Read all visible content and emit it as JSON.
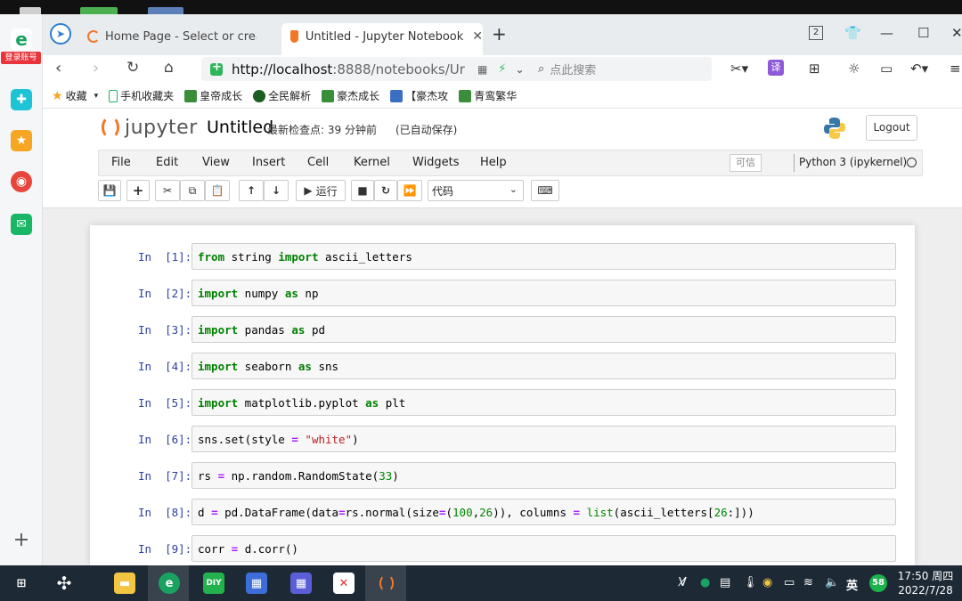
{
  "sidebar": {
    "login_label": "登录账号"
  },
  "tabs": [
    {
      "label": "Home Page - Select or create"
    },
    {
      "label": "Untitled - Jupyter Notebook"
    }
  ],
  "window": {
    "tab_count": "2"
  },
  "address": {
    "url_host": "http://localhost",
    "url_path": ":8888/notebooks/Ur",
    "search_placeholder": "点此搜索",
    "translate_label": "译"
  },
  "bookmarks": [
    {
      "label": "收藏"
    },
    {
      "label": "手机收藏夹"
    },
    {
      "label": "皇帝成长"
    },
    {
      "label": "全民解析"
    },
    {
      "label": "豪杰成长"
    },
    {
      "label": "【豪杰攻"
    },
    {
      "label": "青鸾繁华"
    }
  ],
  "jupyter": {
    "logo_text": "jupyter",
    "notebook_title": "Untitled",
    "checkpoint": "最新检查点: 39 分钟前",
    "autosave": "(已自动保存)",
    "logout_label": "Logout",
    "menu": [
      "File",
      "Edit",
      "View",
      "Insert",
      "Cell",
      "Kernel",
      "Widgets",
      "Help"
    ],
    "trusted_label": "可信",
    "kernel_name": "Python 3 (ipykernel)",
    "run_label": "运行",
    "cell_type": "代码"
  },
  "cells": [
    {
      "prompt": "In  [1]:",
      "code": "from string import ascii_letters"
    },
    {
      "prompt": "In  [2]:",
      "code": "import numpy as np"
    },
    {
      "prompt": "In  [3]:",
      "code": "import pandas as pd"
    },
    {
      "prompt": "In  [4]:",
      "code": "import seaborn as sns"
    },
    {
      "prompt": "In  [5]:",
      "code": "import matplotlib.pyplot as plt"
    },
    {
      "prompt": "In  [6]:",
      "code": "sns.set(style = \"white\")"
    },
    {
      "prompt": "In  [7]:",
      "code": "rs = np.random.RandomState(33)"
    },
    {
      "prompt": "In  [8]:",
      "code": "d = pd.DataFrame(data=rs.normal(size=(100,26)), columns = list(ascii_letters[26:]))"
    },
    {
      "prompt": "In  [9]:",
      "code": "corr = d.corr()"
    }
  ],
  "taskbar": {
    "time": "17:50 周四",
    "date": "2022/7/28",
    "ime": "英",
    "badge": "58"
  }
}
